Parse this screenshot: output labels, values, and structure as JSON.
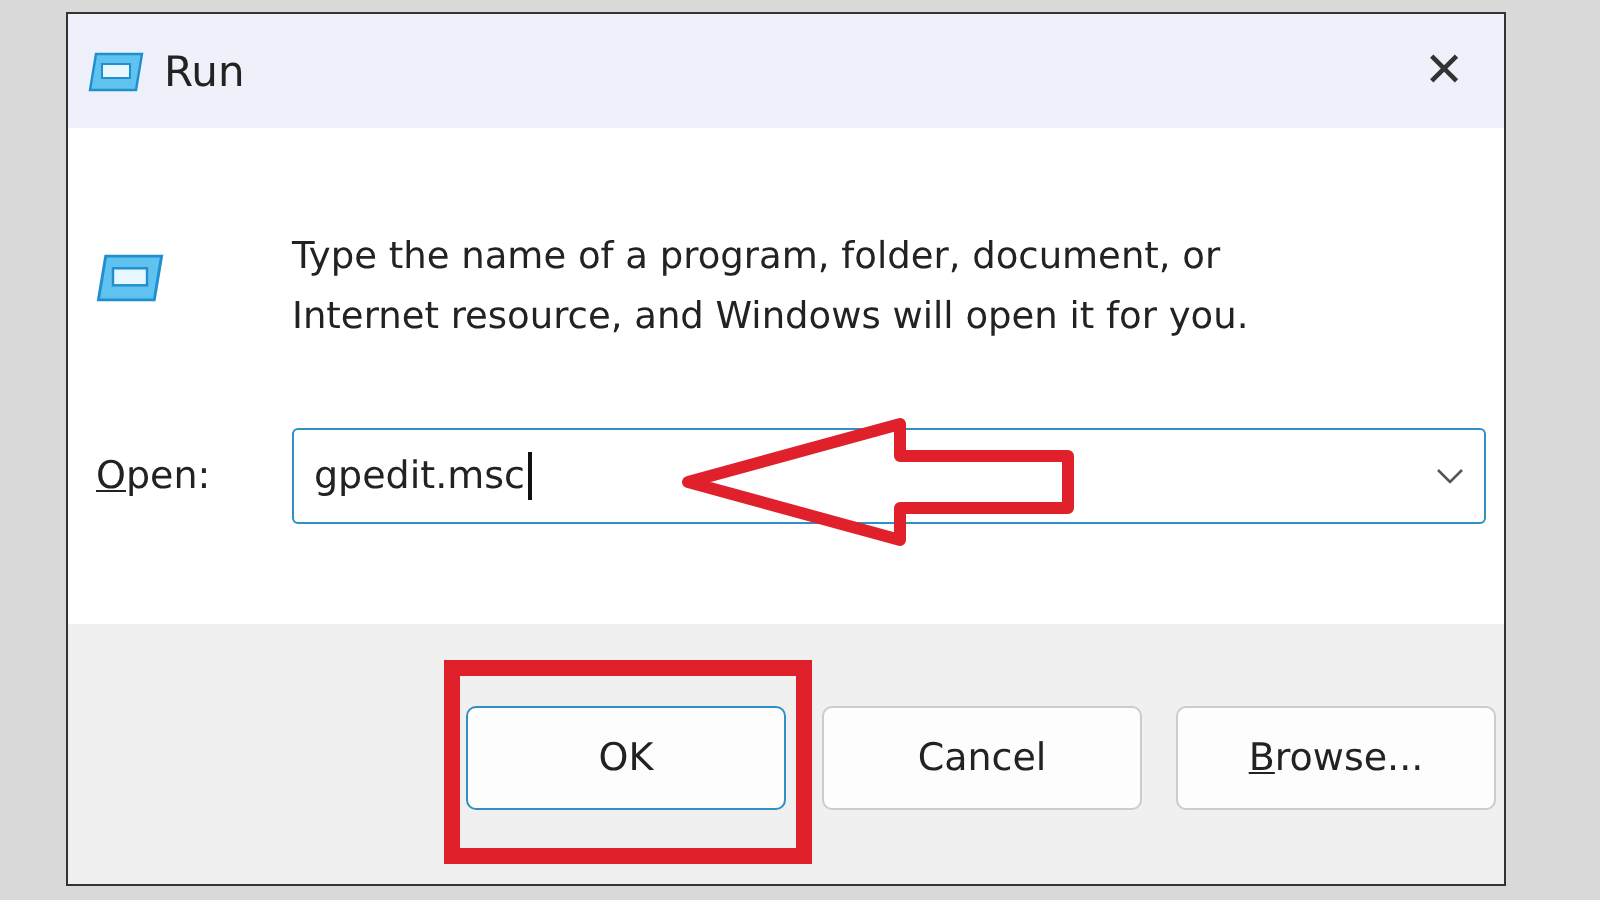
{
  "window": {
    "title": "Run",
    "close": "✕"
  },
  "message": "Type the name of a program, folder, document, or Internet resource, and Windows will open it for you.",
  "open_field": {
    "label": "Open:",
    "label_mnemonic": true,
    "value": "gpedit.msc",
    "focused": true
  },
  "buttons": [
    {
      "label": "OK",
      "mnemonic": false,
      "default": true,
      "highlighted": true
    },
    {
      "label": "Cancel",
      "mnemonic": false,
      "default": false,
      "highlighted": false
    },
    {
      "label": "Browse...",
      "mnemonic": true,
      "default": false,
      "highlighted": false
    }
  ],
  "annotations": [
    {
      "kind": "arrow",
      "color": "#e0202a"
    }
  ]
}
